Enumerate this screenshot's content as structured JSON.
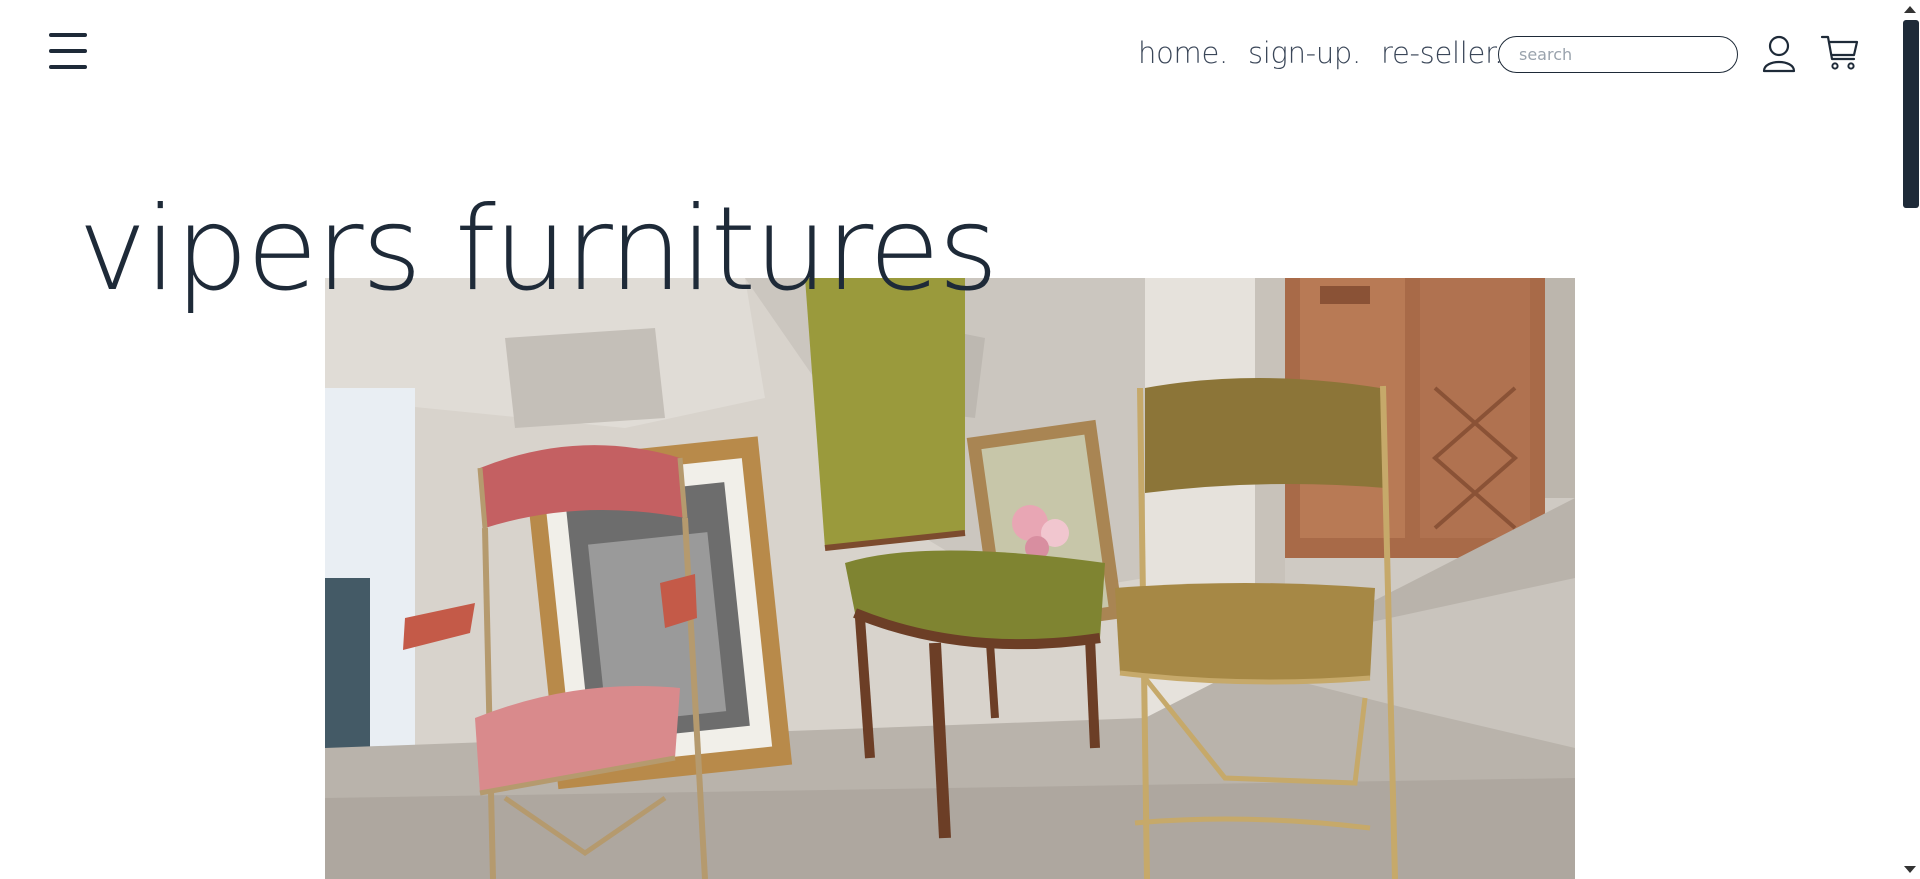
{
  "header": {
    "menu_icon": "hamburger-menu-icon",
    "nav": [
      {
        "label": "home."
      },
      {
        "label": "sign-up."
      },
      {
        "label": "re-seller."
      }
    ],
    "search": {
      "placeholder": "search",
      "value": ""
    },
    "user_icon": "user-icon",
    "cart_icon": "cart-icon"
  },
  "hero": {
    "title": "vipers furnitures",
    "image": "chairs-against-wall-photo"
  },
  "colors": {
    "primary": "#1e2a38",
    "nav_text": "#3a4658",
    "background": "#ffffff"
  }
}
